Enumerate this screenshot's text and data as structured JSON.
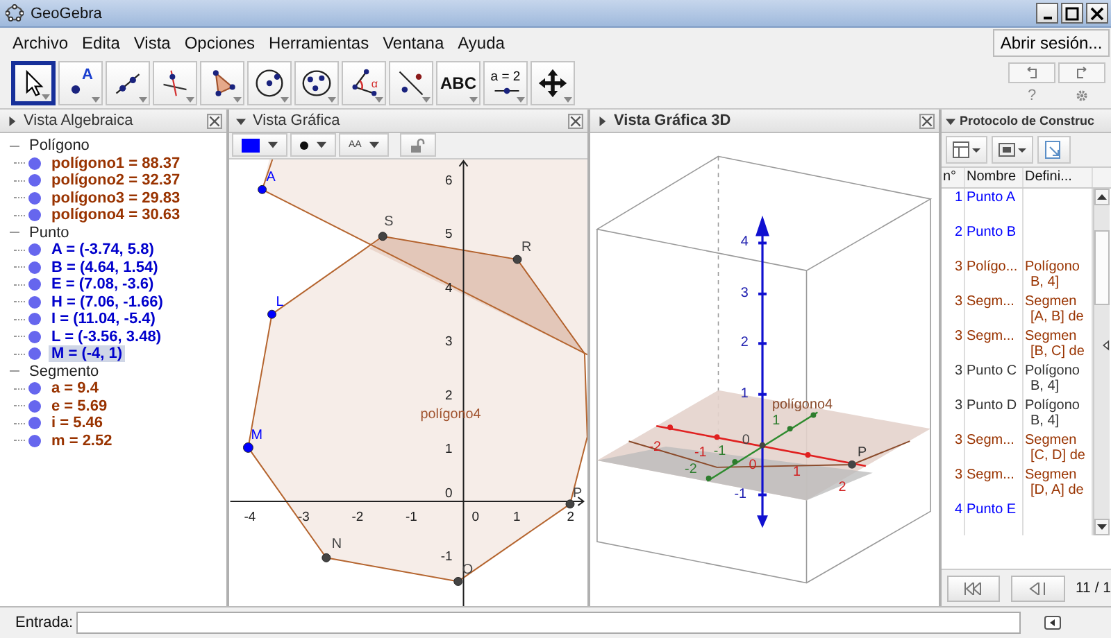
{
  "window": {
    "title": "GeoGebra"
  },
  "menu": [
    "Archivo",
    "Edita",
    "Vista",
    "Opciones",
    "Herramientas",
    "Ventana",
    "Ayuda"
  ],
  "sign_in_button": "Abrir sesión...",
  "tools": [
    {
      "kind": "move",
      "selected": true
    },
    {
      "kind": "point",
      "label": "A",
      "selected": false
    },
    {
      "kind": "line",
      "selected": false
    },
    {
      "kind": "perpendicular",
      "selected": false
    },
    {
      "kind": "polygon",
      "selected": false
    },
    {
      "kind": "circle",
      "selected": false
    },
    {
      "kind": "conic",
      "selected": false
    },
    {
      "kind": "angle",
      "label": "α",
      "selected": false
    },
    {
      "kind": "reflect",
      "selected": false
    },
    {
      "kind": "text",
      "label": "ABC",
      "selected": false
    },
    {
      "kind": "slider",
      "label": "a = 2",
      "selected": false
    },
    {
      "kind": "move-view",
      "selected": false
    }
  ],
  "help": "?",
  "algebra": {
    "title": "Vista Algebraica",
    "style_bar_open": false,
    "groups": [
      {
        "label": "Polígono",
        "expanded": true,
        "items": [
          {
            "text": "polígono1 = 88.37",
            "color": "#993300",
            "selected": false
          },
          {
            "text": "polígono2 = 32.37",
            "color": "#993300",
            "selected": false
          },
          {
            "text": "polígono3 = 29.83",
            "color": "#993300",
            "selected": false
          },
          {
            "text": "polígono4 = 30.63",
            "color": "#993300",
            "selected": false
          }
        ]
      },
      {
        "label": "Punto",
        "expanded": true,
        "items": [
          {
            "text": "A = (-3.74, 5.8)",
            "color": "#0000cc",
            "selected": false
          },
          {
            "text": "B = (4.64, 1.54)",
            "color": "#0000cc",
            "selected": false
          },
          {
            "text": "E = (7.08, -3.6)",
            "color": "#0000cc",
            "selected": false
          },
          {
            "text": "H = (7.06, -1.66)",
            "color": "#0000cc",
            "selected": false
          },
          {
            "text": "I = (11.04, -5.4)",
            "color": "#0000cc",
            "selected": false
          },
          {
            "text": "L = (-3.56, 3.48)",
            "color": "#0000cc",
            "selected": false
          },
          {
            "text": "M = (-4, 1)",
            "color": "#0000cc",
            "selected": true
          }
        ]
      },
      {
        "label": "Segmento",
        "expanded": true,
        "items": [
          {
            "text": "a = 9.4",
            "color": "#993300",
            "selected": false
          },
          {
            "text": "e = 5.69",
            "color": "#993300",
            "selected": false
          },
          {
            "text": "i = 5.46",
            "color": "#993300",
            "selected": false
          },
          {
            "text": "m = 2.52",
            "color": "#993300",
            "selected": false
          }
        ]
      }
    ]
  },
  "graphics": {
    "title": "Vista Gráfica",
    "style_bar_open": true,
    "style_bar": {
      "color": "#0000ff",
      "label_size": "AA"
    },
    "x_ticks": [
      "-4",
      "-3",
      "-2",
      "-1",
      "0",
      "1",
      "2"
    ],
    "y_ticks": [
      "6",
      "5",
      "4",
      "3",
      "2",
      "1",
      "0",
      "-1"
    ],
    "points": [
      {
        "label": "A",
        "color": "#0000ff"
      },
      {
        "label": "S",
        "color": "#444444"
      },
      {
        "label": "R",
        "color": "#444444"
      },
      {
        "label": "L",
        "color": "#0000ff"
      },
      {
        "label": "M",
        "color": "#0000ff"
      },
      {
        "label": "N",
        "color": "#444444"
      },
      {
        "label": "O",
        "color": "#444444"
      },
      {
        "label": "P",
        "color": "#444444"
      }
    ],
    "polygon_label": "polígono4"
  },
  "graphics_3d": {
    "title": "Vista Gráfica 3D",
    "style_bar_open": false,
    "z_ticks": [
      "4",
      "3",
      "2",
      "1",
      "0",
      "-1"
    ],
    "x_ticks": [
      "-2",
      "-1",
      "0",
      "1",
      "2"
    ],
    "y_ticks": [
      "-2",
      "-1",
      "1"
    ],
    "polygon_label": "polígono4",
    "point_label": "P"
  },
  "protocol": {
    "title": "Protocolo de Construc",
    "style_bar_open": true,
    "columns": [
      "n°",
      "Nombre",
      "Defini..."
    ],
    "rows": [
      {
        "number": "1",
        "name": "Punto A",
        "definition": [],
        "color": "#0000ff"
      },
      {
        "number": "2",
        "name": "Punto B",
        "definition": [],
        "color": "#0000ff"
      },
      {
        "number": "3",
        "name": "Polígo...",
        "definition": [
          "Polígono",
          "B, 4]"
        ],
        "color": "#993300"
      },
      {
        "number": "3",
        "name": "Segm...",
        "definition": [
          "Segmen",
          "[A, B] de"
        ],
        "color": "#993300"
      },
      {
        "number": "3",
        "name": "Segm...",
        "definition": [
          "Segmen",
          "[B, C] de"
        ],
        "color": "#993300"
      },
      {
        "number": "3",
        "name": "Punto C",
        "definition": [
          "Polígono",
          "B, 4]"
        ],
        "color": "#333333"
      },
      {
        "number": "3",
        "name": "Punto D",
        "definition": [
          "Polígono",
          "B, 4]"
        ],
        "color": "#333333"
      },
      {
        "number": "3",
        "name": "Segm...",
        "definition": [
          "Segmen",
          "[C, D] de"
        ],
        "color": "#993300"
      },
      {
        "number": "3",
        "name": "Segm...",
        "definition": [
          "Segmen",
          "[D, A] de"
        ],
        "color": "#993300"
      },
      {
        "number": "4",
        "name": "Punto E",
        "definition": [],
        "color": "#0000ff"
      }
    ],
    "step": "11 / 1"
  },
  "input_bar": {
    "label": "Entrada:"
  }
}
